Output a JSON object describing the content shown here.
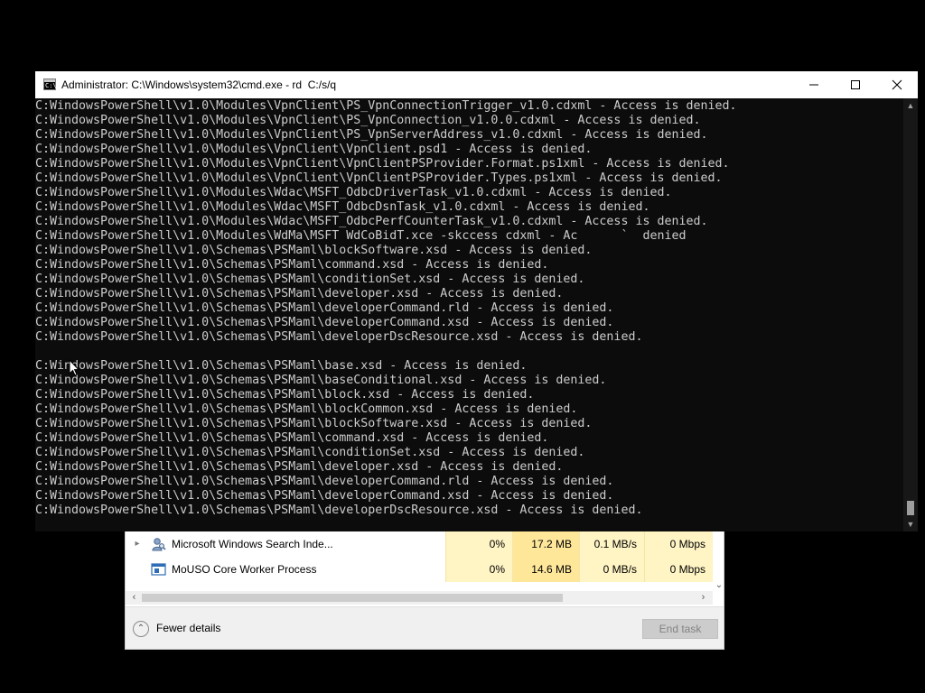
{
  "task_manager": {
    "processes": [
      {
        "name": "Microsoft Windows Search Inde...",
        "expandable": true,
        "icon": "search-indexer-icon",
        "cpu": "0%",
        "memory": "17.2 MB",
        "disk": "0.1 MB/s",
        "network": "0 Mbps"
      },
      {
        "name": "MoUSO Core Worker Process",
        "expandable": false,
        "icon": "process-window-icon",
        "cpu": "0%",
        "memory": "14.6 MB",
        "disk": "0 MB/s",
        "network": "0 Mbps"
      }
    ],
    "fewer_details_label": "Fewer details",
    "end_task_label": "End task",
    "colors": {
      "cpu_highlight": "#fff4c4",
      "memory_highlight": "#ffe79a"
    }
  },
  "cmd_window": {
    "title": "Administrator: C:\\Windows\\system32\\cmd.exe - rd  C:/s/q",
    "icon": "cmd-icon",
    "caption_buttons": [
      "minimize-icon",
      "maximize-icon",
      "close-icon"
    ],
    "lines": [
      "C:WindowsPowerShell\\v1.0\\Modules\\VpnClient\\PS_VpnConnectionTrigger_v1.0.cdxml - Access is denied.",
      "C:WindowsPowerShell\\v1.0\\Modules\\VpnClient\\PS_VpnConnection_v1.0.0.cdxml - Access is denied.",
      "C:WindowsPowerShell\\v1.0\\Modules\\VpnClient\\PS_VpnServerAddress_v1.0.cdxml - Access is denied.",
      "C:WindowsPowerShell\\v1.0\\Modules\\VpnClient\\VpnClient.psd1 - Access is denied.",
      "C:WindowsPowerShell\\v1.0\\Modules\\VpnClient\\VpnClientPSProvider.Format.ps1xml - Access is denied.",
      "C:WindowsPowerShell\\v1.0\\Modules\\VpnClient\\VpnClientPSProvider.Types.ps1xml - Access is denied.",
      "C:WindowsPowerShell\\v1.0\\Modules\\Wdac\\MSFT_OdbcDriverTask_v1.0.cdxml - Access is denied.",
      "C:WindowsPowerShell\\v1.0\\Modules\\Wdac\\MSFT_OdbcDsnTask_v1.0.cdxml - Access is denied.",
      "C:WindowsPowerShell\\v1.0\\Modules\\Wdac\\MSFT_OdbcPerfCounterTask_v1.0.cdxml - Access is denied.",
      "C:WindowsPowerShell\\v1.0\\Modules\\WdMa\\MSFT WdCoBidT.xce -skccess cdxml - Ac      `  denied",
      "C:WindowsPowerShell\\v1.0\\Schemas\\PSMaml\\blockSoftware.xsd - Access is denied.",
      "C:WindowsPowerShell\\v1.0\\Schemas\\PSMaml\\command.xsd - Access is denied.",
      "C:WindowsPowerShell\\v1.0\\Schemas\\PSMaml\\conditionSet.xsd - Access is denied.",
      "C:WindowsPowerShell\\v1.0\\Schemas\\PSMaml\\developer.xsd - Access is denied.",
      "C:WindowsPowerShell\\v1.0\\Schemas\\PSMaml\\developerCommand.rld - Access is denied.",
      "C:WindowsPowerShell\\v1.0\\Schemas\\PSMaml\\developerCommand.xsd - Access is denied.",
      "C:WindowsPowerShell\\v1.0\\Schemas\\PSMaml\\developerDscResource.xsd - Access is denied.",
      "",
      "C:WindowsPowerShell\\v1.0\\Schemas\\PSMaml\\base.xsd - Access is denied.",
      "C:WindowsPowerShell\\v1.0\\Schemas\\PSMaml\\baseConditional.xsd - Access is denied.",
      "C:WindowsPowerShell\\v1.0\\Schemas\\PSMaml\\block.xsd - Access is denied.",
      "C:WindowsPowerShell\\v1.0\\Schemas\\PSMaml\\blockCommon.xsd - Access is denied.",
      "C:WindowsPowerShell\\v1.0\\Schemas\\PSMaml\\blockSoftware.xsd - Access is denied.",
      "C:WindowsPowerShell\\v1.0\\Schemas\\PSMaml\\command.xsd - Access is denied.",
      "C:WindowsPowerShell\\v1.0\\Schemas\\PSMaml\\conditionSet.xsd - Access is denied.",
      "C:WindowsPowerShell\\v1.0\\Schemas\\PSMaml\\developer.xsd - Access is denied.",
      "C:WindowsPowerShell\\v1.0\\Schemas\\PSMaml\\developerCommand.rld - Access is denied.",
      "C:WindowsPowerShell\\v1.0\\Schemas\\PSMaml\\developerCommand.xsd - Access is denied.",
      "C:WindowsPowerShell\\v1.0\\Schemas\\PSMaml\\developerDscResource.xsd - Access is denied."
    ],
    "colors": {
      "console_background": "#0c0c0c",
      "console_text": "#cccccc",
      "titlebar": "#ffffff"
    }
  }
}
